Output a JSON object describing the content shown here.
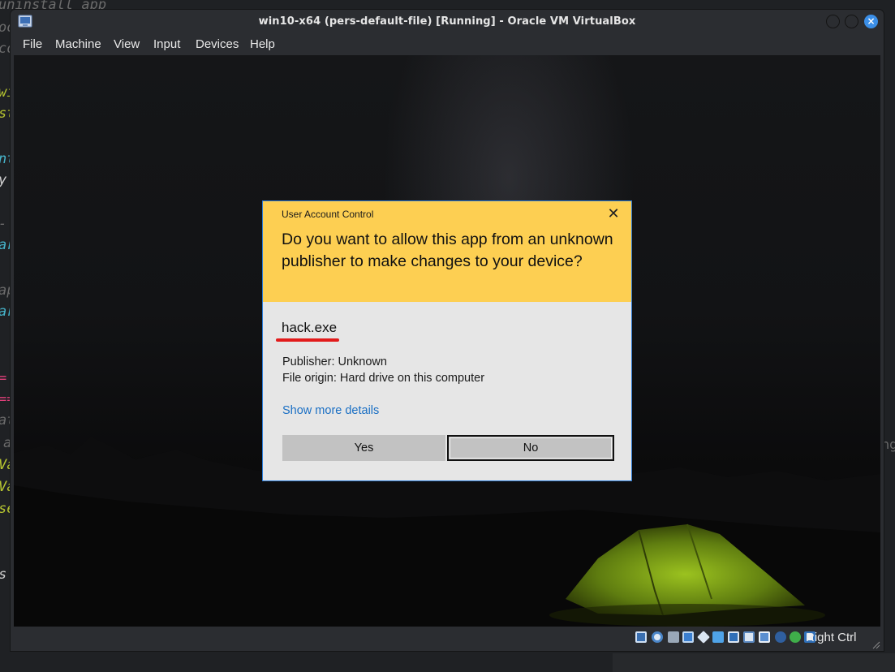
{
  "background": {
    "editor_fragments": [
      "uninstall app",
      "oo",
      "co",
      "wi",
      "st",
      "nt",
      "y",
      "-",
      "ar",
      "ap",
      "ar",
      "=",
      "==",
      "at",
      "a",
      "Va",
      "Va",
      "se",
      "s"
    ],
    "right_fragment": "ng"
  },
  "window": {
    "title": "win10-x64 (pers-default-file) [Running] - Oracle VM VirtualBox",
    "app_icon": "virtualbox-icon",
    "controls": [
      "minimize-icon",
      "maximize-icon",
      "close-icon"
    ],
    "close_glyph": "×"
  },
  "menu": {
    "items": [
      {
        "label": "File"
      },
      {
        "label": "Machine"
      },
      {
        "label": "View"
      },
      {
        "label": "Input"
      },
      {
        "label": "Devices"
      },
      {
        "label": "Help"
      }
    ]
  },
  "uac": {
    "caption": "User Account Control",
    "close_glyph": "✕",
    "question": "Do you want to allow this app from an unknown publisher to make changes to your device?",
    "app_name": "hack.exe",
    "publisher": "Publisher: Unknown",
    "file_origin": "File origin: Hard drive on this computer",
    "more_details": "Show more details",
    "yes_label": "Yes",
    "no_label": "No",
    "colors": {
      "header": "#fdcf52",
      "body": "#e6e6e6",
      "link": "#1a6fc4",
      "annotation": "#e21b1b"
    }
  },
  "statusbar": {
    "icons": [
      "hard-disk-icon",
      "optical-drive-icon",
      "audio-icon",
      "network-icon",
      "usb-icon",
      "shared-folders-icon",
      "display-icon",
      "video-capture-icon",
      "vt-x-icon",
      "guest-additions-icon",
      "mouse-integration-icon",
      "keyboard-icon"
    ],
    "host_key": "Right Ctrl"
  }
}
